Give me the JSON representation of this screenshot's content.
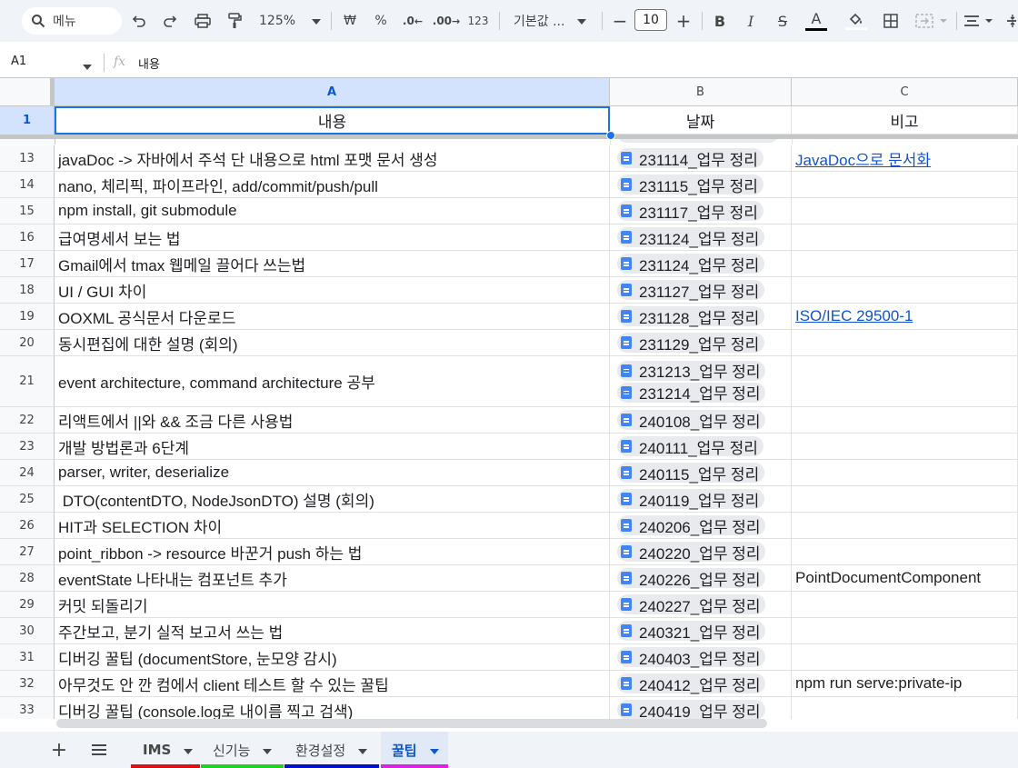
{
  "toolbar": {
    "search_label": "메뉴",
    "zoom": "125%",
    "currency": "₩",
    "percent": "%",
    "decimal_decrease": ".0",
    "decimal_increase": ".00",
    "number_format": "123",
    "font_name": "기본값 ...",
    "font_size": "10",
    "bold": "B",
    "italic": "I",
    "strike": "S",
    "text_color": "A"
  },
  "formula_bar": {
    "cell_ref": "A1",
    "fx": "fx",
    "content": "내용"
  },
  "columns": [
    {
      "label": "A"
    },
    {
      "label": "B"
    },
    {
      "label": "C"
    }
  ],
  "header_row": {
    "number": "1",
    "a": "내용",
    "b": "날짜",
    "c": "비고"
  },
  "rows": [
    {
      "number": "13",
      "a": "javaDoc -> 자바에서 주석 단 내용으로 html 포맷 문서 생성",
      "b": [
        "231114_업무 정리"
      ],
      "c": "JavaDoc으로 문서화",
      "c_link": true
    },
    {
      "number": "14",
      "a": "nano, 체리픽, 파이프라인, add/commit/push/pull",
      "b": [
        "231115_업무 정리"
      ],
      "c": ""
    },
    {
      "number": "15",
      "a": "npm install, git submodule",
      "b": [
        "231117_업무 정리"
      ],
      "c": ""
    },
    {
      "number": "16",
      "a": "급여명세서 보는 법",
      "b": [
        "231124_업무 정리"
      ],
      "c": ""
    },
    {
      "number": "17",
      "a": "Gmail에서 tmax 웹메일 끌어다 쓰는법",
      "b": [
        "231124_업무 정리"
      ],
      "c": ""
    },
    {
      "number": "18",
      "a": "UI / GUI 차이",
      "b": [
        "231127_업무 정리"
      ],
      "c": ""
    },
    {
      "number": "19",
      "a": "OOXML 공식문서 다운로드",
      "b": [
        "231128_업무 정리"
      ],
      "c": "ISO/IEC 29500-1",
      "c_link": true
    },
    {
      "number": "20",
      "a": "동시편집에 대한 설명 (회의)",
      "b": [
        "231129_업무 정리"
      ],
      "c": ""
    },
    {
      "number": "21",
      "a": "event architecture, command architecture 공부",
      "b": [
        "231213_업무 정리",
        "231214_업무 정리"
      ],
      "c": ""
    },
    {
      "number": "22",
      "a": "리액트에서 ||와 && 조금 다른 사용법",
      "b": [
        "240108_업무 정리"
      ],
      "c": ""
    },
    {
      "number": "23",
      "a": "개발 방법론과 6단계",
      "b": [
        "240111_업무 정리"
      ],
      "c": ""
    },
    {
      "number": "24",
      "a": "parser, writer, deserialize",
      "b": [
        "240115_업무 정리"
      ],
      "c": ""
    },
    {
      "number": "25",
      "a": " DTO(contentDTO, NodeJsonDTO) 설명 (회의)",
      "b": [
        "240119_업무 정리"
      ],
      "c": ""
    },
    {
      "number": "26",
      "a": "HIT과 SELECTION 차이",
      "b": [
        "240206_업무 정리"
      ],
      "c": ""
    },
    {
      "number": "27",
      "a": "point_ribbon -> resource 바꾼거 push 하는 법",
      "b": [
        "240220_업무 정리"
      ],
      "c": ""
    },
    {
      "number": "28",
      "a": "eventState 나타내는 컴포넌트 추가",
      "b": [
        "240226_업무 정리"
      ],
      "c": "PointDocumentComponent"
    },
    {
      "number": "29",
      "a": "커밋 되돌리기",
      "b": [
        "240227_업무 정리"
      ],
      "c": ""
    },
    {
      "number": "30",
      "a": "주간보고, 분기 실적 보고서 쓰는 법",
      "b": [
        "240321_업무 정리"
      ],
      "c": ""
    },
    {
      "number": "31",
      "a": "디버깅 꿀팁 (documentStore, 눈모양 감시)",
      "b": [
        "240403_업무 정리"
      ],
      "c": ""
    },
    {
      "number": "32",
      "a": "아무것도 안 깐 컴에서 client 테스트 할 수 있는 꿀팁",
      "b": [
        "240412_업무 정리"
      ],
      "c": "npm run serve:private-ip"
    },
    {
      "number": "33",
      "a": "디버깅 꿀팁 (console.log로 내이름 찍고 검색)",
      "b": [
        "240419_업무 정리"
      ],
      "c": ""
    }
  ],
  "sheet_tabs": [
    {
      "label": "IMS",
      "color": "#e0101b"
    },
    {
      "label": "신기능",
      "color": "#1fd21f"
    },
    {
      "label": "환경설정",
      "color": "#0010d0"
    },
    {
      "label": "꿀팁",
      "color": "#e020e0",
      "active": true
    }
  ],
  "colors": {
    "accent": "#1a73e8",
    "link": "#1155cc",
    "selected_header": "#d3e3fd"
  }
}
